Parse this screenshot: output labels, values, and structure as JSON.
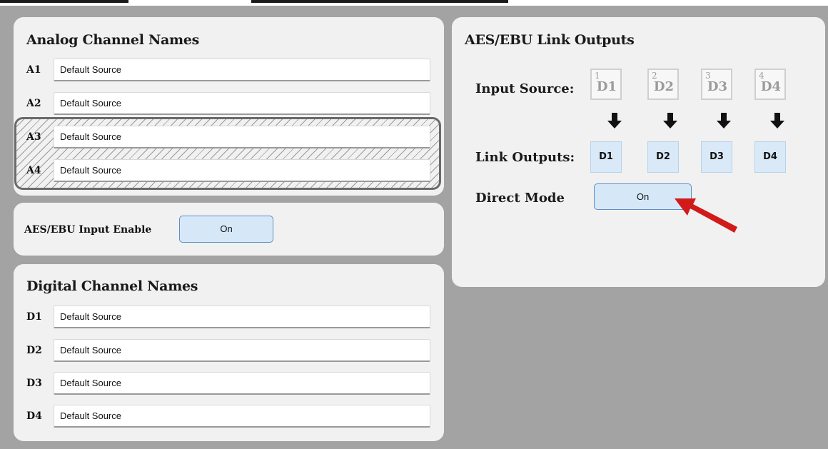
{
  "analog_panel": {
    "title": "Analog Channel Names",
    "channels": [
      {
        "label": "A1",
        "value": "Default Source"
      },
      {
        "label": "A2",
        "value": "Default Source"
      },
      {
        "label": "A3",
        "value": "Default Source"
      },
      {
        "label": "A4",
        "value": "Default Source"
      }
    ]
  },
  "aes_input": {
    "label": "AES/EBU Input Enable",
    "button": "On"
  },
  "digital_panel": {
    "title": "Digital Channel Names",
    "channels": [
      {
        "label": "D1",
        "value": "Default Source"
      },
      {
        "label": "D2",
        "value": "Default Source"
      },
      {
        "label": "D3",
        "value": "Default Source"
      },
      {
        "label": "D4",
        "value": "Default Source"
      }
    ]
  },
  "link_panel": {
    "title": "AES/EBU Link Outputs",
    "input_source_label": "Input Source:",
    "sources": [
      {
        "num": "1",
        "label": "D1"
      },
      {
        "num": "2",
        "label": "D2"
      },
      {
        "num": "3",
        "label": "D3"
      },
      {
        "num": "4",
        "label": "D4"
      }
    ],
    "link_outputs_label": "Link Outputs:",
    "outputs": [
      "D1",
      "D2",
      "D3",
      "D4"
    ],
    "direct_mode_label": "Direct Mode",
    "direct_mode_button": "On"
  },
  "colors": {
    "background": "#a3a3a3",
    "panel": "#f1f1f1",
    "button_fill": "#d6e8f8",
    "button_border": "#5c8fc4",
    "annotation_arrow": "#d11a1a"
  }
}
